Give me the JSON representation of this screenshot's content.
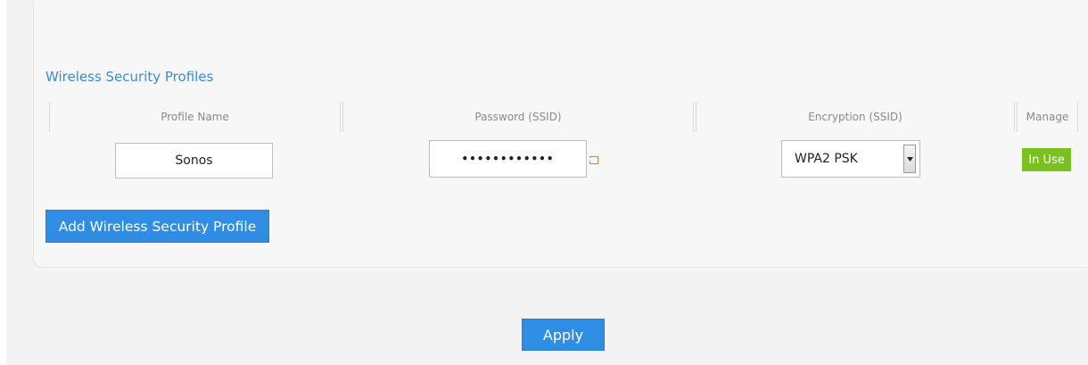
{
  "section": {
    "title": "Wireless Security Profiles"
  },
  "table": {
    "headers": [
      "Profile Name",
      "Password (SSID)",
      "Encryption (SSID)",
      "Manage"
    ],
    "rows": [
      {
        "profile_name": "Sonos",
        "password_masked": "••••••••••••",
        "encryption": "WPA2 PSK",
        "status": "In Use"
      }
    ]
  },
  "buttons": {
    "add_profile_label": "Add Wireless Security Profile",
    "apply_label": "Apply"
  },
  "icons": {
    "password_reveal": "reveal-password-icon",
    "select_arrow": "chevron-down-icon"
  },
  "colors": {
    "accent": "#2f8de4",
    "title": "#3a8ad6",
    "status_in_use": "#79c11e",
    "reveal_icon": "#e57a2e"
  }
}
